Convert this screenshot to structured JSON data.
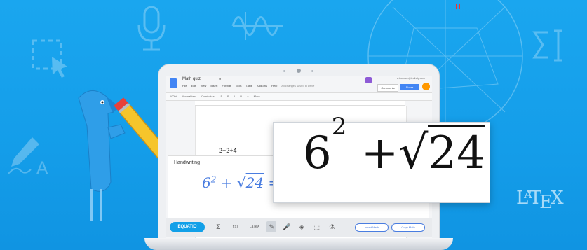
{
  "decor": {
    "icons": [
      "selection-icon",
      "microphone-icon",
      "waveform-icon",
      "handwriting-icon",
      "sigma-icon",
      "geometry-icon"
    ],
    "latex_logo": {
      "l": "L",
      "a": "A",
      "t": "T",
      "e": "E",
      "x": "X"
    },
    "brand_color": "#1aa6ef"
  },
  "docs": {
    "title": "Math quiz",
    "menu": [
      "File",
      "Edit",
      "View",
      "Insert",
      "Format",
      "Tools",
      "Table",
      "Add-ons",
      "Help"
    ],
    "saved_status": "All changes saved in Drive",
    "account": "a.thomson@texthelp.com",
    "comments_label": "Comments",
    "share_label": "Share",
    "toolbar": [
      "100%",
      "Normal text",
      "Comfortaa",
      "11",
      "B",
      "I",
      "U",
      "A",
      "More"
    ],
    "body_text": "2+2+4"
  },
  "handwriting_panel": {
    "title": "Handwriting",
    "expression": {
      "base": "6",
      "exponent": "2",
      "operator": "+",
      "radical": "√",
      "radicand": "24",
      "equals": "="
    }
  },
  "equatio": {
    "brand": "EQUATIO",
    "tools": [
      "Σ",
      "f(x)",
      "LaTeX",
      "✎",
      "🎤",
      "◈",
      "⬚",
      "⚗"
    ],
    "insert_label": "Insert Math",
    "copy_label": "Copy Math"
  },
  "zoom": {
    "base": "6",
    "exponent": "2",
    "operator": "+",
    "radical": "√",
    "radicand": "24"
  }
}
